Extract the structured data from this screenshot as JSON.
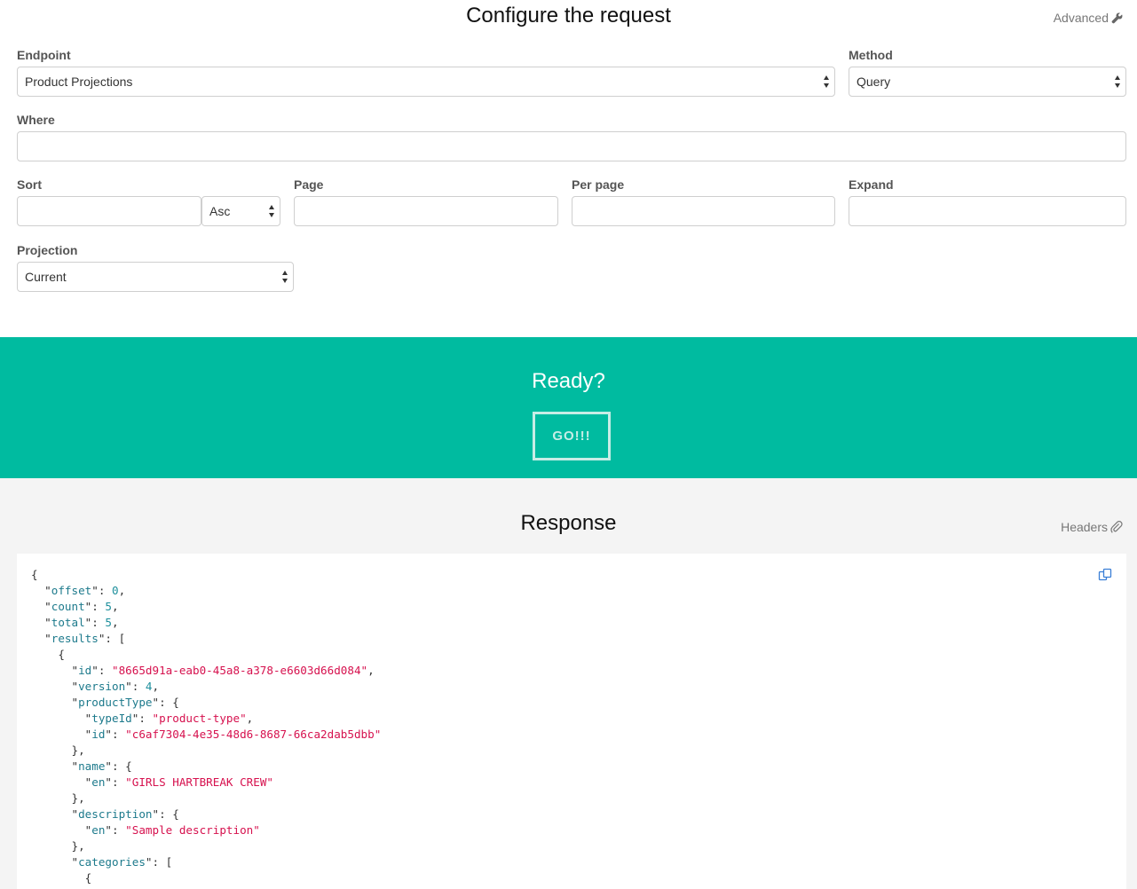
{
  "config": {
    "title": "Configure the request",
    "advanced_label": "Advanced",
    "endpoint": {
      "label": "Endpoint",
      "value": "Product Projections"
    },
    "method": {
      "label": "Method",
      "value": "Query"
    },
    "where": {
      "label": "Where",
      "value": ""
    },
    "sort": {
      "label": "Sort",
      "value": "",
      "direction": "Asc"
    },
    "page": {
      "label": "Page",
      "value": ""
    },
    "per_page": {
      "label": "Per page",
      "value": ""
    },
    "expand": {
      "label": "Expand",
      "value": ""
    },
    "projection": {
      "label": "Projection",
      "value": "Current"
    }
  },
  "ready": {
    "title": "Ready?",
    "go_label": "GO!!!"
  },
  "response": {
    "title": "Response",
    "headers_label": "Headers",
    "lines": [
      [
        {
          "t": "p",
          "v": "{"
        }
      ],
      [
        {
          "t": "p",
          "v": "  \""
        },
        {
          "t": "k",
          "v": "offset"
        },
        {
          "t": "p",
          "v": "\": "
        },
        {
          "t": "n",
          "v": "0"
        },
        {
          "t": "p",
          "v": ","
        }
      ],
      [
        {
          "t": "p",
          "v": "  \""
        },
        {
          "t": "k",
          "v": "count"
        },
        {
          "t": "p",
          "v": "\": "
        },
        {
          "t": "n",
          "v": "5"
        },
        {
          "t": "p",
          "v": ","
        }
      ],
      [
        {
          "t": "p",
          "v": "  \""
        },
        {
          "t": "k",
          "v": "total"
        },
        {
          "t": "p",
          "v": "\": "
        },
        {
          "t": "n",
          "v": "5"
        },
        {
          "t": "p",
          "v": ","
        }
      ],
      [
        {
          "t": "p",
          "v": "  \""
        },
        {
          "t": "k",
          "v": "results"
        },
        {
          "t": "p",
          "v": "\": ["
        }
      ],
      [
        {
          "t": "p",
          "v": "    {"
        }
      ],
      [
        {
          "t": "p",
          "v": "      \""
        },
        {
          "t": "k",
          "v": "id"
        },
        {
          "t": "p",
          "v": "\": "
        },
        {
          "t": "s",
          "v": "\"8665d91a-eab0-45a8-a378-e6603d66d084\""
        },
        {
          "t": "p",
          "v": ","
        }
      ],
      [
        {
          "t": "p",
          "v": "      \""
        },
        {
          "t": "k",
          "v": "version"
        },
        {
          "t": "p",
          "v": "\": "
        },
        {
          "t": "n",
          "v": "4"
        },
        {
          "t": "p",
          "v": ","
        }
      ],
      [
        {
          "t": "p",
          "v": "      \""
        },
        {
          "t": "k",
          "v": "productType"
        },
        {
          "t": "p",
          "v": "\": {"
        }
      ],
      [
        {
          "t": "p",
          "v": "        \""
        },
        {
          "t": "k",
          "v": "typeId"
        },
        {
          "t": "p",
          "v": "\": "
        },
        {
          "t": "s",
          "v": "\"product-type\""
        },
        {
          "t": "p",
          "v": ","
        }
      ],
      [
        {
          "t": "p",
          "v": "        \""
        },
        {
          "t": "k",
          "v": "id"
        },
        {
          "t": "p",
          "v": "\": "
        },
        {
          "t": "s",
          "v": "\"c6af7304-4e35-48d6-8687-66ca2dab5dbb\""
        }
      ],
      [
        {
          "t": "p",
          "v": "      },"
        }
      ],
      [
        {
          "t": "p",
          "v": "      \""
        },
        {
          "t": "k",
          "v": "name"
        },
        {
          "t": "p",
          "v": "\": {"
        }
      ],
      [
        {
          "t": "p",
          "v": "        \""
        },
        {
          "t": "k",
          "v": "en"
        },
        {
          "t": "p",
          "v": "\": "
        },
        {
          "t": "s",
          "v": "\"GIRLS HARTBREAK CREW\""
        }
      ],
      [
        {
          "t": "p",
          "v": "      },"
        }
      ],
      [
        {
          "t": "p",
          "v": "      \""
        },
        {
          "t": "k",
          "v": "description"
        },
        {
          "t": "p",
          "v": "\": {"
        }
      ],
      [
        {
          "t": "p",
          "v": "        \""
        },
        {
          "t": "k",
          "v": "en"
        },
        {
          "t": "p",
          "v": "\": "
        },
        {
          "t": "s",
          "v": "\"Sample description\""
        }
      ],
      [
        {
          "t": "p",
          "v": "      },"
        }
      ],
      [
        {
          "t": "p",
          "v": "      \""
        },
        {
          "t": "k",
          "v": "categories"
        },
        {
          "t": "p",
          "v": "\": ["
        }
      ],
      [
        {
          "t": "p",
          "v": "        {"
        }
      ]
    ]
  },
  "colors": {
    "accent": "#00bba0",
    "json_key": "#1d7a8c",
    "json_string": "#d6114e",
    "json_number": "#1d8f9c"
  },
  "icons": [
    "wrench-icon",
    "paperclip-icon",
    "copy-icon",
    "select-arrows-icon"
  ]
}
